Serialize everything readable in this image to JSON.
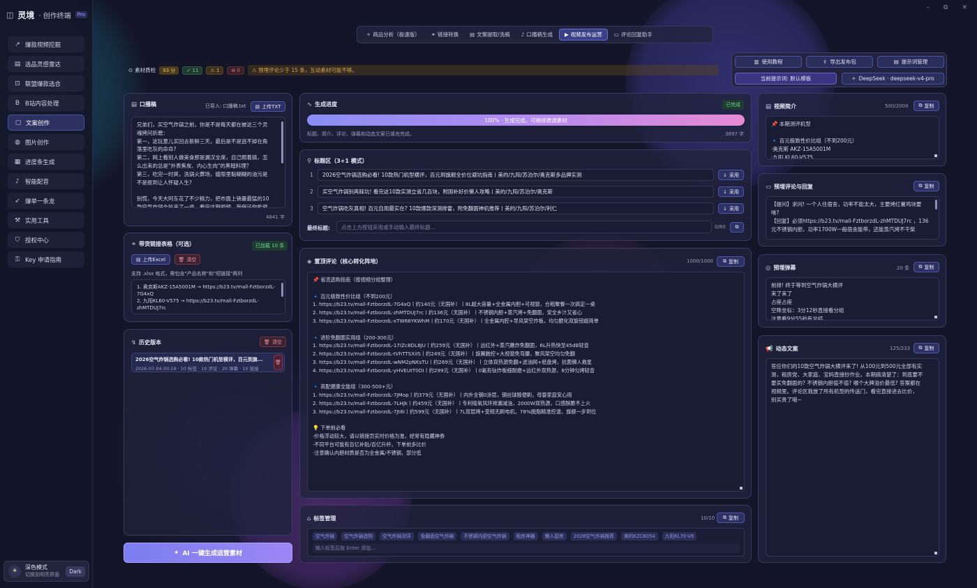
{
  "sidebar": {
    "brand_name": "灵境",
    "brand_sub": "· 创作终端",
    "badge": "Pro",
    "items": [
      {
        "label": "爆款视频挖掘",
        "icon": "trend-icon"
      },
      {
        "label": "选品灵感雷达",
        "icon": "radar-icon"
      },
      {
        "label": "联盟爆款选合",
        "icon": "cart-icon"
      },
      {
        "label": "B站内容处理",
        "icon": "bilibili-icon"
      },
      {
        "label": "文案创作",
        "icon": "document-icon",
        "active": true
      },
      {
        "label": "图片创作",
        "icon": "palette-icon"
      },
      {
        "label": "进度条生成",
        "icon": "film-icon"
      },
      {
        "label": "智能配音",
        "icon": "mic-icon"
      },
      {
        "label": "爆单一条龙",
        "icon": "rocket-icon"
      },
      {
        "label": "实用工具",
        "icon": "wrench-icon"
      },
      {
        "label": "授权中心",
        "icon": "shield-icon"
      },
      {
        "label": "Key 申请指南",
        "icon": "key-icon"
      }
    ],
    "theme_title": "深色模式",
    "theme_sub": "切换到明亮界面",
    "theme_btn": "Dark"
  },
  "top_tabs": [
    {
      "label": "商品分析（极速版）",
      "icon": "sparkle-icon"
    },
    {
      "label": "链接转换",
      "icon": "link-icon"
    },
    {
      "label": "文案提取/洗稿",
      "icon": "document-icon"
    },
    {
      "label": "口播稿生成",
      "icon": "mic-icon"
    },
    {
      "label": "视频发布运营",
      "icon": "video-icon",
      "active": true
    },
    {
      "label": "评论回复助手",
      "icon": "comment-icon"
    }
  ],
  "quality": {
    "label": "素材质检",
    "score": "93 分",
    "ok": "11",
    "warn": "1",
    "err": "0",
    "warning_text": "预埋评论少于 15 条，互动素材可能不够。"
  },
  "toolbar": {
    "tutorial": "使用教程",
    "export": "导出发布包",
    "prompt_mgmt": "提示词管理",
    "current_prompt": "当前提示词: 默认模板",
    "model": "DeepSeek · deepseek-v4-pro"
  },
  "script_panel": {
    "title": "口播稿",
    "imported": "已导入: 口播稿.txt",
    "upload": "上传TXT",
    "lines": [
      "兄弟们，买空气炸锅之前，你是不是每天都在被这三个灵",
      "魂拷问折磨：",
      "第一，这玩意儿买回去新鲜三天，最后是不是逃不掉在角",
      "落里吃灰的命命?",
      "第二，网上看别人做美食那是漏汉全席，自己照着搞，怎",
      "么出来的总是\"外表焦炭、内心生肉\"的黑暗料理？",
      "第三，吃完一时爽，洗锅火葬场，缝隙里黏糊糊的油污是",
      "不是抠到让人怀疑人生?",
      "",
      "别慌，今天大阿东花了不少精力，把市面上销量最猛的10",
      "款空气炸锅全拎来了一遍，看完这期视频，我保证你能避"
    ],
    "count": "4841 字"
  },
  "links_panel": {
    "title": "带货链接表格（可选）",
    "status": "已加载 10 条",
    "upload": "上传Excel",
    "clear": "清空",
    "hint": "支持 .xlsx 格式，需包含\"产品名称\"和\"短链接\"两列",
    "lines": [
      "1. 奥克斯AKZ-15A5001M → https://b23.tv/mall-FztborzdL-",
      "7G4xQ",
      "2. 九阳KL60-V575 → https://b23.tv/mall-FztborzdL-",
      "zhMTDUJ7rc"
    ]
  },
  "history_panel": {
    "title": "历史版本",
    "clear": "清空",
    "item_title": "2026空气炸锅选购必看! 10款热门机型横评，百元到旗...",
    "item_meta": "2026-07-04 00:19 · 10 标签 · 10 评论 · 20 弹幕 · 10 链接"
  },
  "generate_btn": "AI 一键生成运营素材",
  "progress_panel": {
    "title": "生成进度",
    "status": "已完成",
    "bar_text": "100% · 生成完成，可继续微调素材",
    "progress": 1.0,
    "footer": "标题、简介、评论、弹幕和动态文案已填充完成。",
    "count": "3897 字"
  },
  "titles_panel": {
    "title": "标题区（3+1 模式）",
    "rows": [
      "2026空气炸锅选购必看! 10款热门机型横评，百元到旗舰全价位避坑指南丨美的/九阳/苏泊尔/奥克斯多品牌实测",
      "买空气炸锅别再踩坑! 看完这10款实测立省几百块，附国补好价懒人攻略丨美的/九阳/苏泊尔/奥克斯",
      "空气炸锅吃灰真相! 百元自用最实在? 10款爆款深测排雷，附免翻面神机推荐丨美的/九阳/苏泊尔/利仁"
    ],
    "adopt": "采用",
    "final_label": "最终标题:",
    "final_placeholder": "点击上方按钮采用或手动输入最终标题...",
    "final_count": "0/80"
  },
  "pinned_panel": {
    "title": "置顶评论（核心转化阵地）",
    "count": "1000/1000",
    "copy": "复制",
    "lines": [
      "📌 省流选购指南（按视频分组整理）",
      "",
      "🔹 百元极致性价比组（不到200元）",
      "1. https://b23.tv/mall-FztborzdL-7G4xQ丨约140元（无国补）丨8L超大容量+全金属内胆+可视窗，合租聚餐一次搞定一桌",
      "2. https://b23.tv/mall-FztborzdL-zhMTDUJ7rc丨约136元（无国补）丨不锈钢内胆+蒸汽烤+免翻面，安全乡汁又省心",
      "3. https://b23.tv/mall-FztborzdL-xTW68YKWhM丨约170元（无国补）丨全金属内腔+导风架空炸板，均匀脆化双旋钮超简单",
      "",
      "🔹 进阶免翻面实用组（200-300元）",
      "1. https://b23.tv/mall-FztborzdL-17IZc8DL8JU丨约259元（无国补）丨远红外+蒸汽嫩炸免翻面，6L升热快至45dB轻音",
      "2. https://b23.tv/mall-FztborzdL-tVhTTSXiIS丨约249元（无国补）丨旋翼触控+大视窗免弯腰，聚风架空均匀免翻",
      "3. https://b23.tv/mall-FztborzdL-wNM2pNKsTU丨约269元（无国补）丨立体双热源免翻+滤油网+纸盘烤，抗菌懒人救星",
      "4. https://b23.tv/mall-FztborzdL-yHVEUtT0DI丨约299元（无国补）丨0氟有钛炸板细耐磨+远红外双热源，8分钟匀烤轻音",
      "",
      "🔹 高配健康全能组（300-500+元）",
      "1. https://b23.tv/mall-FztborzdL-7JMop丨约379元（无国补）丨内外全钢0涂层，钢丝球随便刷，母婴家庭安心用",
      "2. https://b23.tv/mall-FztborzdL-7LHJk丨约459元（无国补）丨专利吸氧风环排漏减油，2000W双热源，口感酥脆不上火",
      "3. https://b23.tv/mall-FztborzdL-7Jt6I丨约599元（无国补）丨7L双层烤+变频无刷电机，78%脱脂精准控温，旗舰一步到位",
      "",
      "💡 下单前必看",
      "·价格浮动较大，请以链接页实时价格为准，经常有隐藏神券",
      "·不同平台可能有百亿补贴/百亿升杯，下单前多比价",
      "·注意确认内胆材质是否为全金属/不锈钢，部分低"
    ]
  },
  "tags_panel": {
    "title": "标签管理",
    "count": "10/10",
    "copy": "复制",
    "tags": [
      "空气炸锅",
      "空气炸锅选购",
      "空气炸锅测评",
      "免翻面空气炸锅",
      "不锈钢内胆空气炸锅",
      "租房神器",
      "懒人厨房",
      "2026空气炸锅推荐",
      "美的KZC6054",
      "九阳KL70-V8"
    ],
    "placeholder": "输入标签后按 Enter 添加..."
  },
  "intro_panel": {
    "title": "视频简介",
    "count": "500/2000",
    "copy": "复制",
    "lines": [
      "📌 本期测评机型",
      "",
      "🔹 百元极致性价比组（不到200元）",
      "·奥克斯 AKZ-15A5001M",
      "·九阳 KL60-V575"
    ]
  },
  "reply_panel": {
    "title": "预埋评论与回复",
    "copy": "复制",
    "lines": [
      "【提问】求问! 一个人住宿舍，功率不能太大，主要烤红薯鸡块要",
      "啥?",
      "【回复】必须https://b23.tv/mall-FztborzdL-zhMTDUJ7rc ，136",
      "元不锈钢内胆，功率1700W一般宿舍能带，还能蒸汽烤不干柴"
    ]
  },
  "danmaku_panel": {
    "title": "预埋弹幕",
    "count": "20 条",
    "copy": "复制",
    "lines": [
      "前排! 终于等到空气炸锅大横评",
      "来了来了",
      "占座占座",
      "空降坐标：3分12秒直接看分组",
      "注意看9分55秒有总结"
    ]
  },
  "dynamic_panel": {
    "title": "动态文案",
    "count": "125/233",
    "copy": "复制",
    "lines": [
      "答应你们的10款空气炸锅大横评来了! 从100元到500元全部有实",
      "测，租房党、大家庭、宝妈直接抄作业。本期搞清楚了：到底要不",
      "要买免翻面的? 不锈钢内胆值不值? 哪个大牌溢价最低? 答案都在",
      "视频里。评论区我放了所有机型的传送门，看完直接进去比价，",
      "别买贵了哦~"
    ]
  }
}
